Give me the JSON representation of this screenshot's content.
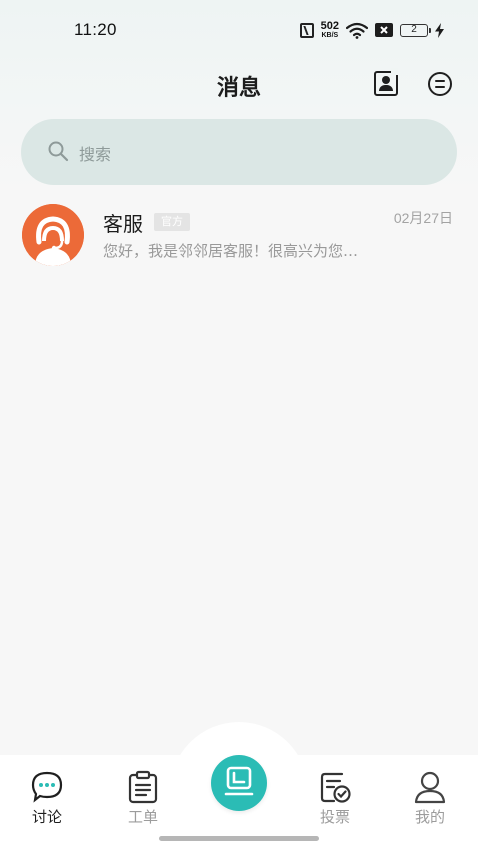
{
  "status_bar": {
    "time": "11:20",
    "net_speed_value": "502",
    "net_speed_unit": "KB/S",
    "battery_level": "2",
    "icons": [
      "nfc-icon",
      "wifi-icon",
      "sim-disabled-icon",
      "battery-icon",
      "charging-icon"
    ]
  },
  "header": {
    "title": "消息",
    "contacts_icon": "contacts-icon",
    "menu_icon": "menu-icon"
  },
  "search": {
    "placeholder": "搜索",
    "icon": "search-icon"
  },
  "conversations": [
    {
      "name": "客服",
      "badge": "官方",
      "date": "02月27日",
      "preview": "您好，我是邻邻居客服！很高兴为您服务",
      "avatar_icon": "customer-service-avatar",
      "avatar_color": "#ec6a38"
    }
  ],
  "tab_bar": {
    "items": [
      {
        "label": "讨论",
        "icon": "chat-bubble-icon",
        "active": true
      },
      {
        "label": "工单",
        "icon": "clipboard-icon",
        "active": false
      },
      {
        "label": "",
        "icon": "publish-icon",
        "active": false
      },
      {
        "label": "投票",
        "icon": "vote-icon",
        "active": false
      },
      {
        "label": "我的",
        "icon": "user-icon",
        "active": false
      }
    ],
    "accent_color": "#2bbcb5"
  }
}
